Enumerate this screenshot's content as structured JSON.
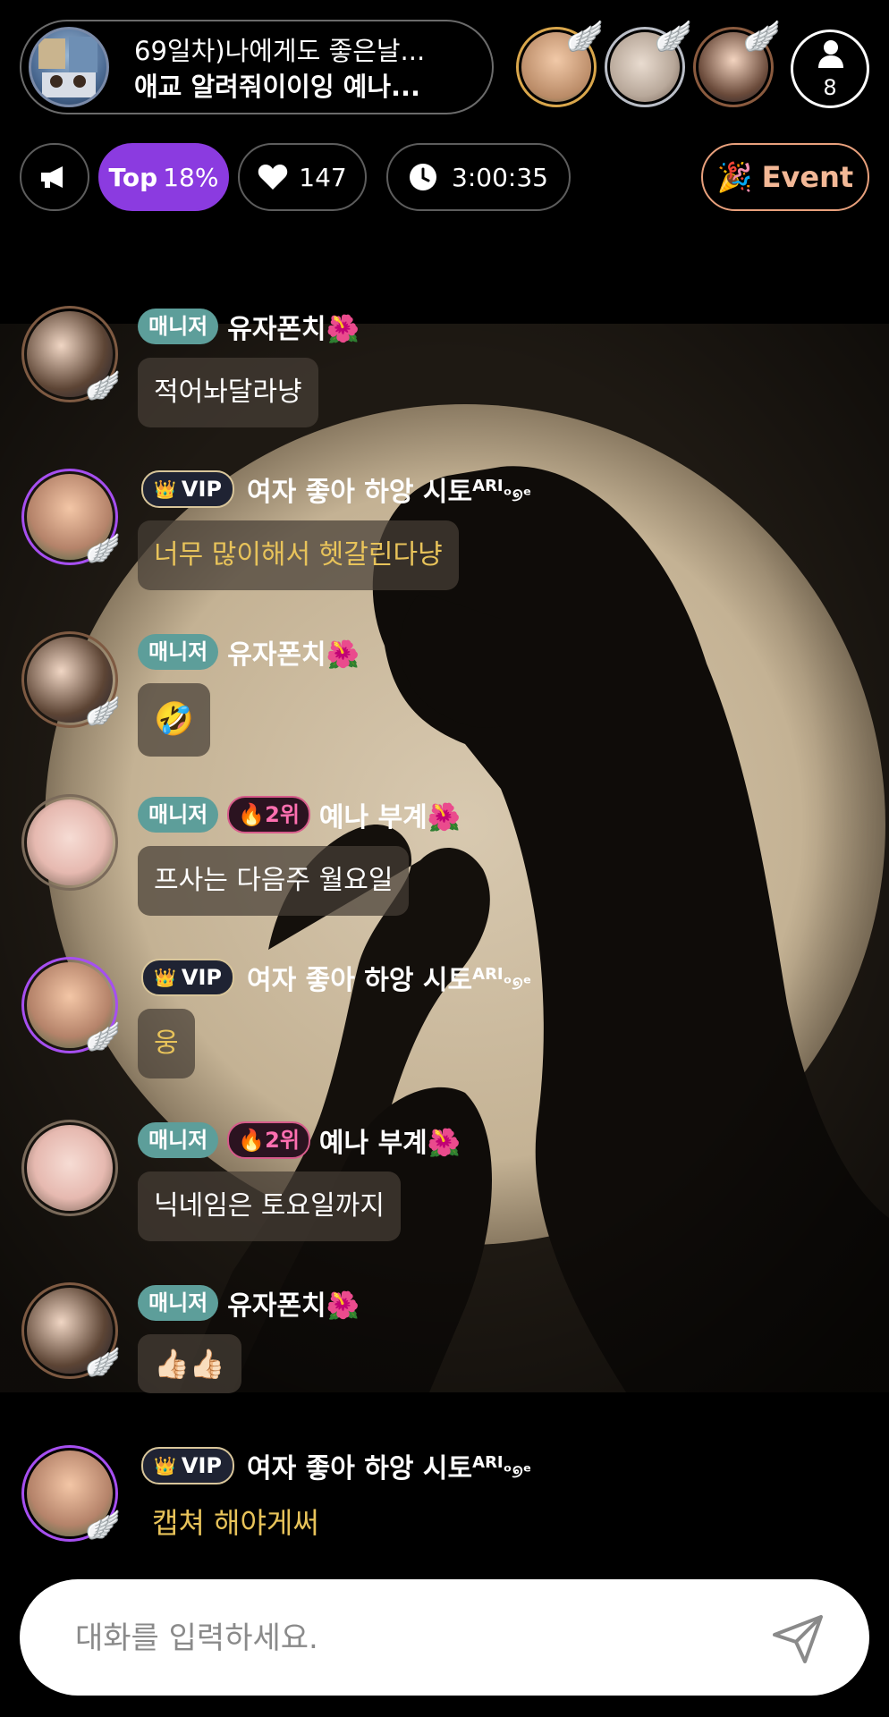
{
  "header": {
    "title": "69일차)나에게도 좋은날...",
    "subtitle": "애교 알려줘이이잉  예나...",
    "viewer_count": "8"
  },
  "stats": {
    "top_label": "Top",
    "top_value": "18%",
    "likes": "147",
    "elapsed": "3:00:35",
    "event_label": "Event"
  },
  "chat": [
    {
      "tag": "매니저",
      "name": "유자폰치🌺",
      "text": "적어놔달라냥"
    },
    {
      "tag": "VIP",
      "name": "여자 좋아 하앙 시토",
      "name_sup": "ARI",
      "name_tail": "ᵒ୭ᵉ",
      "text": "너무 많이해서 헷갈린다냥"
    },
    {
      "tag": "매니저",
      "name": "유자폰치🌺",
      "text": "🤣"
    },
    {
      "tag": "매니저",
      "rank": "2위",
      "name": "예나 부계🌺",
      "text": "프사는 다음주 월요일"
    },
    {
      "tag": "VIP",
      "name": "여자 좋아 하앙 시토",
      "name_sup": "ARI",
      "name_tail": "ᵒ୭ᵉ",
      "text": "웅"
    },
    {
      "tag": "매니저",
      "rank": "2위",
      "name": "예나 부계🌺",
      "text": "닉네임은 토요일까지"
    },
    {
      "tag": "매니저",
      "name": "유자폰치🌺",
      "text": "👍🏻👍🏻"
    },
    {
      "tag": "VIP",
      "name": "여자 좋아 하앙 시토",
      "name_sup": "ARI",
      "name_tail": "ᵒ୭ᵉ",
      "text": "캡쳐 해야게써"
    }
  ],
  "input": {
    "placeholder": "대화를 입력하세요."
  },
  "colors": {
    "accent_purple": "#8b3be0",
    "manager_tag": "#5d9e9a",
    "vip_text": "#e8c35a",
    "event_border": "#e8a07c"
  }
}
